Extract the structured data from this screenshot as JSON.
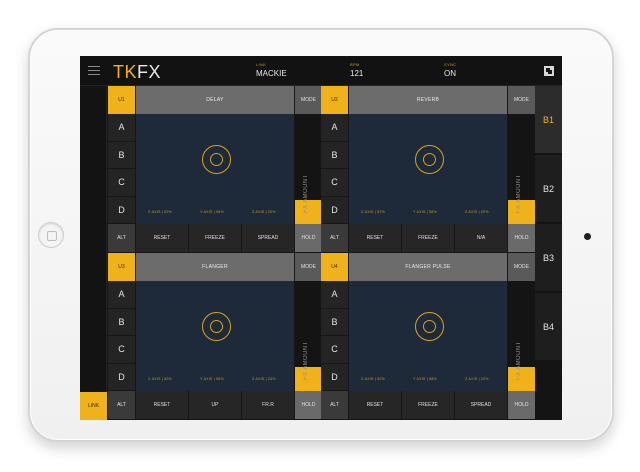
{
  "app": {
    "logo_tk": "TK",
    "logo_fx": "FX",
    "accent": "#f0b21a"
  },
  "header": {
    "link": {
      "label": "LINK",
      "value": "MACKIE"
    },
    "bpm": {
      "label": "BPM",
      "value": "121"
    },
    "sync": {
      "label": "SYNC",
      "value": "ON"
    }
  },
  "sidebar": {
    "link_label": "LINK"
  },
  "letters": [
    "A",
    "B",
    "C",
    "D"
  ],
  "fx_amount_label": "FX AMOUNT",
  "units": [
    {
      "id": "U1",
      "name": "DELAY",
      "mode": "MODE",
      "x_axis": "X AXIS | 52%",
      "y_axis": "Y AXIS | 58%",
      "z_axis": "Z AXIS | 20%",
      "alt": "ALT",
      "buttons": [
        "RESET",
        "FREEZE",
        "SPREAD"
      ],
      "hold": "HOLD"
    },
    {
      "id": "U2",
      "name": "REVERB",
      "mode": "MODE",
      "x_axis": "X AXIS | 52%",
      "y_axis": "Y AXIS | 58%",
      "z_axis": "Z AXIS | 20%",
      "alt": "ALT",
      "buttons": [
        "RESET",
        "FREEZE",
        "N/A"
      ],
      "hold": "HOLD"
    },
    {
      "id": "U3",
      "name": "FLANGER",
      "mode": "MODE",
      "x_axis": "X AXIS | 52%",
      "y_axis": "Y AXIS | 58%",
      "z_axis": "Z AXIS | 23%",
      "alt": "ALT",
      "buttons": [
        "RESET",
        "UP",
        "FR.R"
      ],
      "hold": "HOLD"
    },
    {
      "id": "U4",
      "name": "FLANGER PULSE",
      "mode": "MODE",
      "x_axis": "X AXIS | 52%",
      "y_axis": "Y AXIS | 58%",
      "z_axis": "Z AXIS | 23%",
      "alt": "ALT",
      "buttons": [
        "RESET",
        "FREEZE",
        "SPREAD"
      ],
      "hold": "HOLD"
    }
  ],
  "banks": [
    "B1",
    "B2",
    "B3",
    "B4"
  ],
  "active_bank": "B1"
}
